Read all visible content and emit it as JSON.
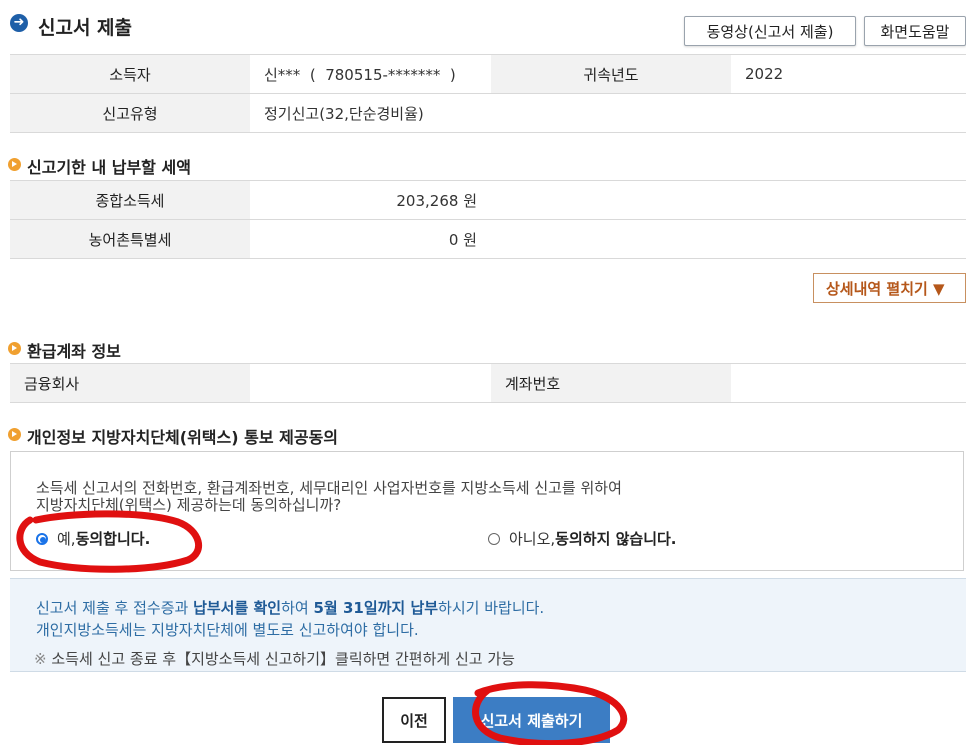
{
  "header": {
    "title": "신고서 제출",
    "video_button": "동영상(신고서 제출)",
    "help_button": "화면도움말"
  },
  "filing_info": {
    "taxpayer_label": "소득자",
    "taxpayer_value": "신***  (  780515-*******  )",
    "year_label": "귀속년도",
    "year_value": "2022",
    "type_label": "신고유형",
    "type_value": "정기신고(32,단순경비율)"
  },
  "tax_due": {
    "section_title": "신고기한 내 납부할 세액",
    "rows": [
      {
        "label": "종합소득세",
        "value": "203,268 원"
      },
      {
        "label": "농어촌특별세",
        "value": "0 원"
      }
    ],
    "detail_button": "상세내역 펼치기 ▼"
  },
  "refund_account": {
    "section_title": "환급계좌 정보",
    "bank_label": "금융회사",
    "bank_value": "",
    "account_label": "계좌번호",
    "account_value": ""
  },
  "consent": {
    "section_title": "개인정보 지방자치단체(위택스) 통보 제공동의",
    "question_line1": "소득세 신고서의 전화번호, 환급계좌번호, 세무대리인 사업자번호를 지방소득세 신고를 위하여",
    "question_line2": "지방자치단체(위택스) 제공하는데 동의하십니까?",
    "yes_prefix": "예, ",
    "yes_bold": "동의합니다.",
    "no_prefix": "아니오, ",
    "no_bold": "동의하지 않습니다.",
    "selected": "yes"
  },
  "notice": {
    "line1_a": "신고서 제출 후 접수증과 ",
    "line1_b": "납부서를 확인",
    "line1_c": "하여 ",
    "line1_d": "5월 31일까지 납부",
    "line1_e": "하시기 바랍니다.",
    "line2": "개인지방소득세는 지방자치단체에 별도로 신고하여야 합니다.",
    "note_mark": "※",
    "note": "소득세 신고 종료 후【지방소득세 신고하기】클릭하면 간편하게 신고 가능"
  },
  "actions": {
    "prev_button": "이전",
    "submit_button": "신고서 제출하기"
  },
  "colors": {
    "accent_blue": "#3c7dc4",
    "bullet_orange": "#f0a030",
    "annotation_red": "#e01010"
  }
}
